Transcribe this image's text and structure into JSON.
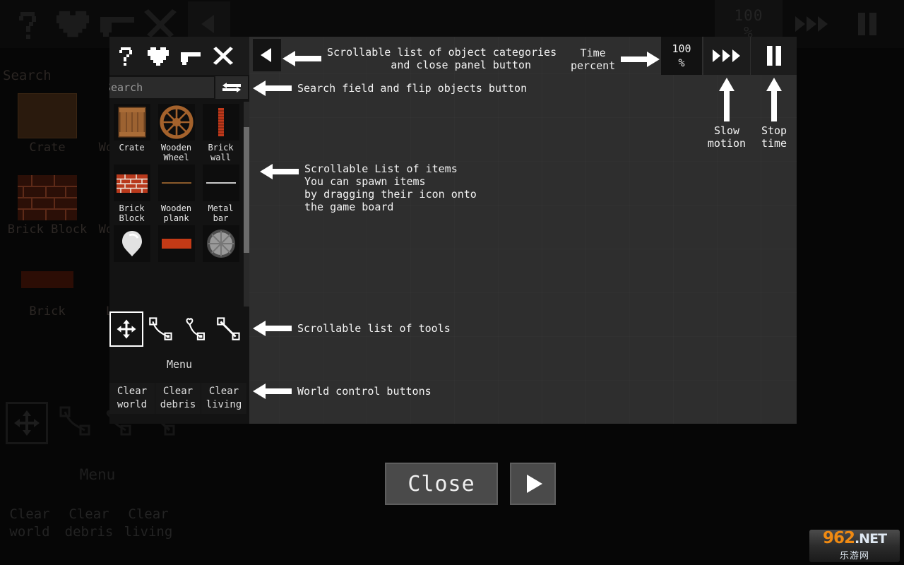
{
  "app": {
    "background_search_placeholder": "Search",
    "background_menu_label": "Menu"
  },
  "topbar": {
    "icons": [
      {
        "name": "help-icon",
        "glyph": "?"
      },
      {
        "name": "heart-icon",
        "glyph": "♥"
      },
      {
        "name": "gun-icon",
        "glyph": "gun"
      },
      {
        "name": "swords-icon",
        "glyph": "swords"
      }
    ],
    "back_label": "◀",
    "time_percent_value": "100",
    "time_percent_unit": "%",
    "fast_forward_label": "▸▸▸",
    "pause_label": "pause"
  },
  "panel": {
    "categories": [
      {
        "name": "category-help",
        "glyph": "?"
      },
      {
        "name": "category-heart",
        "glyph": "♥"
      },
      {
        "name": "category-gun",
        "glyph": "gun"
      },
      {
        "name": "category-swords",
        "glyph": "swords"
      }
    ],
    "search": {
      "placeholder": "Search",
      "value": "Search"
    },
    "flip_label": "flip",
    "items": [
      [
        {
          "label": "Crate",
          "kind": "crate"
        },
        {
          "label": "Wooden\nWheel",
          "kind": "wheel"
        },
        {
          "label": "Brick\nwall",
          "kind": "brickwall"
        }
      ],
      [
        {
          "label": "Brick\nBlock",
          "kind": "brickblock"
        },
        {
          "label": "Wooden\nplank",
          "kind": "woodplank"
        },
        {
          "label": "Metal\nbar",
          "kind": "metalbar"
        }
      ],
      [
        {
          "label": "",
          "kind": "balloon"
        },
        {
          "label": "",
          "kind": "redbar"
        },
        {
          "label": "",
          "kind": "graywheel"
        }
      ]
    ],
    "tools": [
      {
        "name": "move-tool",
        "selected": true
      },
      {
        "name": "rope-tool",
        "selected": false
      },
      {
        "name": "spring-tool",
        "selected": false
      },
      {
        "name": "rod-tool",
        "selected": false
      }
    ],
    "menu_label": "Menu",
    "world_controls": [
      {
        "label": "Clear\nworld"
      },
      {
        "label": "Clear\ndebris"
      },
      {
        "label": "Clear\nliving"
      }
    ]
  },
  "annotations": [
    {
      "id": "categories",
      "text": "Scrollable list of object categories\n          and close panel button",
      "direction": "left"
    },
    {
      "id": "search",
      "text": "Search field and flip objects button",
      "direction": "left"
    },
    {
      "id": "items",
      "text": "Scrollable List of items\nYou can spawn items\nby dragging their icon onto\nthe game board",
      "direction": "left"
    },
    {
      "id": "tools",
      "text": "Scrollable list of tools",
      "direction": "left"
    },
    {
      "id": "world",
      "text": "World control buttons",
      "direction": "left"
    },
    {
      "id": "time-percent",
      "text": "Time\npercent",
      "direction": "right"
    },
    {
      "id": "slow-motion",
      "text": "Slow\nmotion",
      "direction": "up"
    },
    {
      "id": "stop-time",
      "text": "Stop\ntime",
      "direction": "up"
    }
  ],
  "footer": {
    "close_label": "Close",
    "play_label": "▶"
  },
  "watermark": {
    "digits": "962",
    "dot_net": ".NET",
    "chinese": "乐游网"
  },
  "colors": {
    "overlay_bg": "#2e2e2e",
    "panel_bg": "#131313",
    "accent_wood": "#8a5a2b",
    "accent_brick": "#c0391b",
    "text": "#f2f2f2",
    "button": "#4a4a4a"
  }
}
